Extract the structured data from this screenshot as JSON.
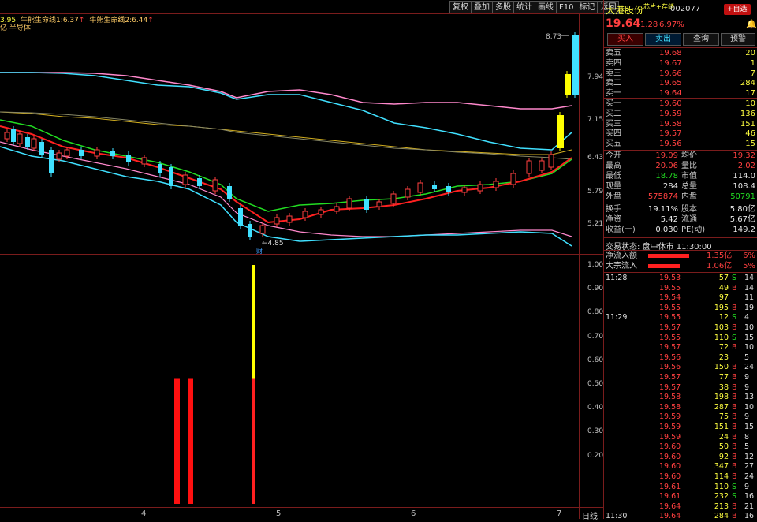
{
  "toolbar": [
    "复权",
    "叠加",
    "多股",
    "统计",
    "画线",
    "F10",
    "标记",
    "返回"
  ],
  "indicator_header": {
    "value1": "3.95",
    "line1_label": "牛熊生命线1:",
    "line1_value": "6.37",
    "line2_label": "牛熊生命线2:",
    "line2_value": "6.44",
    "arrow": "↑"
  },
  "sector_tag": "亿 半导体",
  "price_axis": [
    "8.73",
    "7.94",
    "7.15",
    "6.43",
    "5.79",
    "5.21"
  ],
  "low_marker": "4.85",
  "low_tag": "财",
  "lower_axis": [
    "1.00",
    "0.90",
    "0.80",
    "0.70",
    "0.60",
    "0.50",
    "0.40",
    "0.30",
    "0.20"
  ],
  "x_axis": [
    "4",
    "5",
    "6",
    "7"
  ],
  "period_label": "日线",
  "stock": {
    "name": "大港股份",
    "concept": "芯片+存储",
    "code": "002077",
    "add_fav": "+自选",
    "price": "19.64",
    "change": "1.28",
    "change_pct": "6.97%"
  },
  "trade_buttons": [
    "买入",
    "卖出",
    "查询",
    "预警"
  ],
  "asks": [
    {
      "label": "卖五",
      "price": "19.68",
      "vol": "20"
    },
    {
      "label": "卖四",
      "price": "19.67",
      "vol": "1"
    },
    {
      "label": "卖三",
      "price": "19.66",
      "vol": "7"
    },
    {
      "label": "卖二",
      "price": "19.65",
      "vol": "284"
    },
    {
      "label": "卖一",
      "price": "19.64",
      "vol": "17"
    }
  ],
  "bids": [
    {
      "label": "买一",
      "price": "19.60",
      "vol": "10"
    },
    {
      "label": "买二",
      "price": "19.59",
      "vol": "136"
    },
    {
      "label": "买三",
      "price": "19.58",
      "vol": "151"
    },
    {
      "label": "买四",
      "price": "19.57",
      "vol": "46"
    },
    {
      "label": "买五",
      "price": "19.56",
      "vol": "15"
    }
  ],
  "stats": [
    {
      "l1": "今开",
      "v1": "19.09",
      "l2": "均价",
      "v2": "19.32"
    },
    {
      "l1": "最高",
      "v1": "20.06",
      "l2": "量比",
      "v2": "2.02"
    },
    {
      "l1": "最低",
      "v1": "18.78",
      "l2": "市值",
      "v2": "114.0"
    },
    {
      "l1": "现量",
      "v1": "284",
      "l2": "总量",
      "v2": "108.4"
    },
    {
      "l1": "外盘",
      "v1": "575874",
      "l2": "内盘",
      "v2": "50791"
    }
  ],
  "stats2": [
    {
      "l1": "换手",
      "v1": "19.11%",
      "l2": "股本",
      "v2": "5.80亿"
    },
    {
      "l1": "净资",
      "v1": "5.42",
      "l2": "流通",
      "v2": "5.67亿"
    },
    {
      "l1": "收益(一)",
      "v1": "0.030",
      "l2": "PE(动)",
      "v2": "149.2"
    }
  ],
  "trade_status": "交易状态: 盘中休市 11:30:00",
  "flows": [
    {
      "label": "净流入额",
      "value": "1.35亿",
      "pct": "6%"
    },
    {
      "label": "大宗流入",
      "value": "1.06亿",
      "pct": "5%"
    }
  ],
  "ticks": [
    {
      "t": "11:28",
      "p": "19.53",
      "v": "57",
      "d": "S",
      "n": "14"
    },
    {
      "t": "",
      "p": "19.55",
      "v": "49",
      "d": "B",
      "n": "14"
    },
    {
      "t": "",
      "p": "19.54",
      "v": "97",
      "d": "",
      "n": "11"
    },
    {
      "t": "",
      "p": "19.55",
      "v": "195",
      "d": "B",
      "n": "19"
    },
    {
      "t": "11:29",
      "p": "19.55",
      "v": "12",
      "d": "S",
      "n": "4"
    },
    {
      "t": "",
      "p": "19.57",
      "v": "103",
      "d": "B",
      "n": "10"
    },
    {
      "t": "",
      "p": "19.55",
      "v": "110",
      "d": "S",
      "n": "15"
    },
    {
      "t": "",
      "p": "19.57",
      "v": "72",
      "d": "B",
      "n": "10"
    },
    {
      "t": "",
      "p": "19.56",
      "v": "23",
      "d": "",
      "n": "5"
    },
    {
      "t": "",
      "p": "19.56",
      "v": "150",
      "d": "B",
      "n": "24"
    },
    {
      "t": "",
      "p": "19.57",
      "v": "77",
      "d": "B",
      "n": "9"
    },
    {
      "t": "",
      "p": "19.57",
      "v": "38",
      "d": "B",
      "n": "9"
    },
    {
      "t": "",
      "p": "19.58",
      "v": "198",
      "d": "B",
      "n": "13"
    },
    {
      "t": "",
      "p": "19.58",
      "v": "287",
      "d": "B",
      "n": "10"
    },
    {
      "t": "",
      "p": "19.59",
      "v": "75",
      "d": "B",
      "n": "9"
    },
    {
      "t": "",
      "p": "19.59",
      "v": "151",
      "d": "B",
      "n": "15"
    },
    {
      "t": "",
      "p": "19.59",
      "v": "24",
      "d": "B",
      "n": "8"
    },
    {
      "t": "",
      "p": "19.60",
      "v": "50",
      "d": "B",
      "n": "5"
    },
    {
      "t": "",
      "p": "19.60",
      "v": "92",
      "d": "B",
      "n": "12"
    },
    {
      "t": "",
      "p": "19.60",
      "v": "347",
      "d": "B",
      "n": "27"
    },
    {
      "t": "",
      "p": "19.60",
      "v": "114",
      "d": "B",
      "n": "24"
    },
    {
      "t": "",
      "p": "19.61",
      "v": "110",
      "d": "S",
      "n": "9"
    },
    {
      "t": "",
      "p": "19.61",
      "v": "232",
      "p2": "",
      "d": "S",
      "n": "16"
    },
    {
      "t": "",
      "p": "19.64",
      "v": "213",
      "d": "B",
      "n": "21"
    },
    {
      "t": "11:30",
      "p": "19.64",
      "v": "284",
      "d": "B",
      "n": "16"
    }
  ],
  "colors": {
    "up": "#ff4040",
    "down": "#40e0ff",
    "flat": "#e8e8e8",
    "frame": "#7a1c1c"
  }
}
